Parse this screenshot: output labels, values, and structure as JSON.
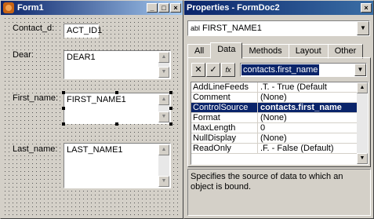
{
  "form": {
    "title": "Form1",
    "labels": {
      "contact": "Contact_d:",
      "dear": "Dear:",
      "first": "First_name:",
      "last": "Last_name:"
    },
    "fields": {
      "contact": "ACT_ID1",
      "dear": "DEAR1",
      "first": "FIRST_NAME1",
      "last": "LAST_NAME1"
    }
  },
  "properties": {
    "title": "Properties - FormDoc2",
    "object_prefix": "abl",
    "object": "FIRST_NAME1",
    "tabs": [
      "All",
      "Data",
      "Methods",
      "Layout",
      "Other"
    ],
    "selected_tab": "Data",
    "value_editor": "contacts.first_name",
    "rows": [
      {
        "name": "AddLineFeeds",
        "value": ".T. - True (Default"
      },
      {
        "name": "Comment",
        "value": "(None)"
      },
      {
        "name": "ControlSource",
        "value": "contacts.first_name"
      },
      {
        "name": "Format",
        "value": "(None)"
      },
      {
        "name": "MaxLength",
        "value": "0"
      },
      {
        "name": "NullDisplay",
        "value": "(None)"
      },
      {
        "name": "ReadOnly",
        "value": ".F. - False (Default)"
      }
    ],
    "selected_row": 2,
    "description": "Specifies the source of data to which an object is bound."
  }
}
